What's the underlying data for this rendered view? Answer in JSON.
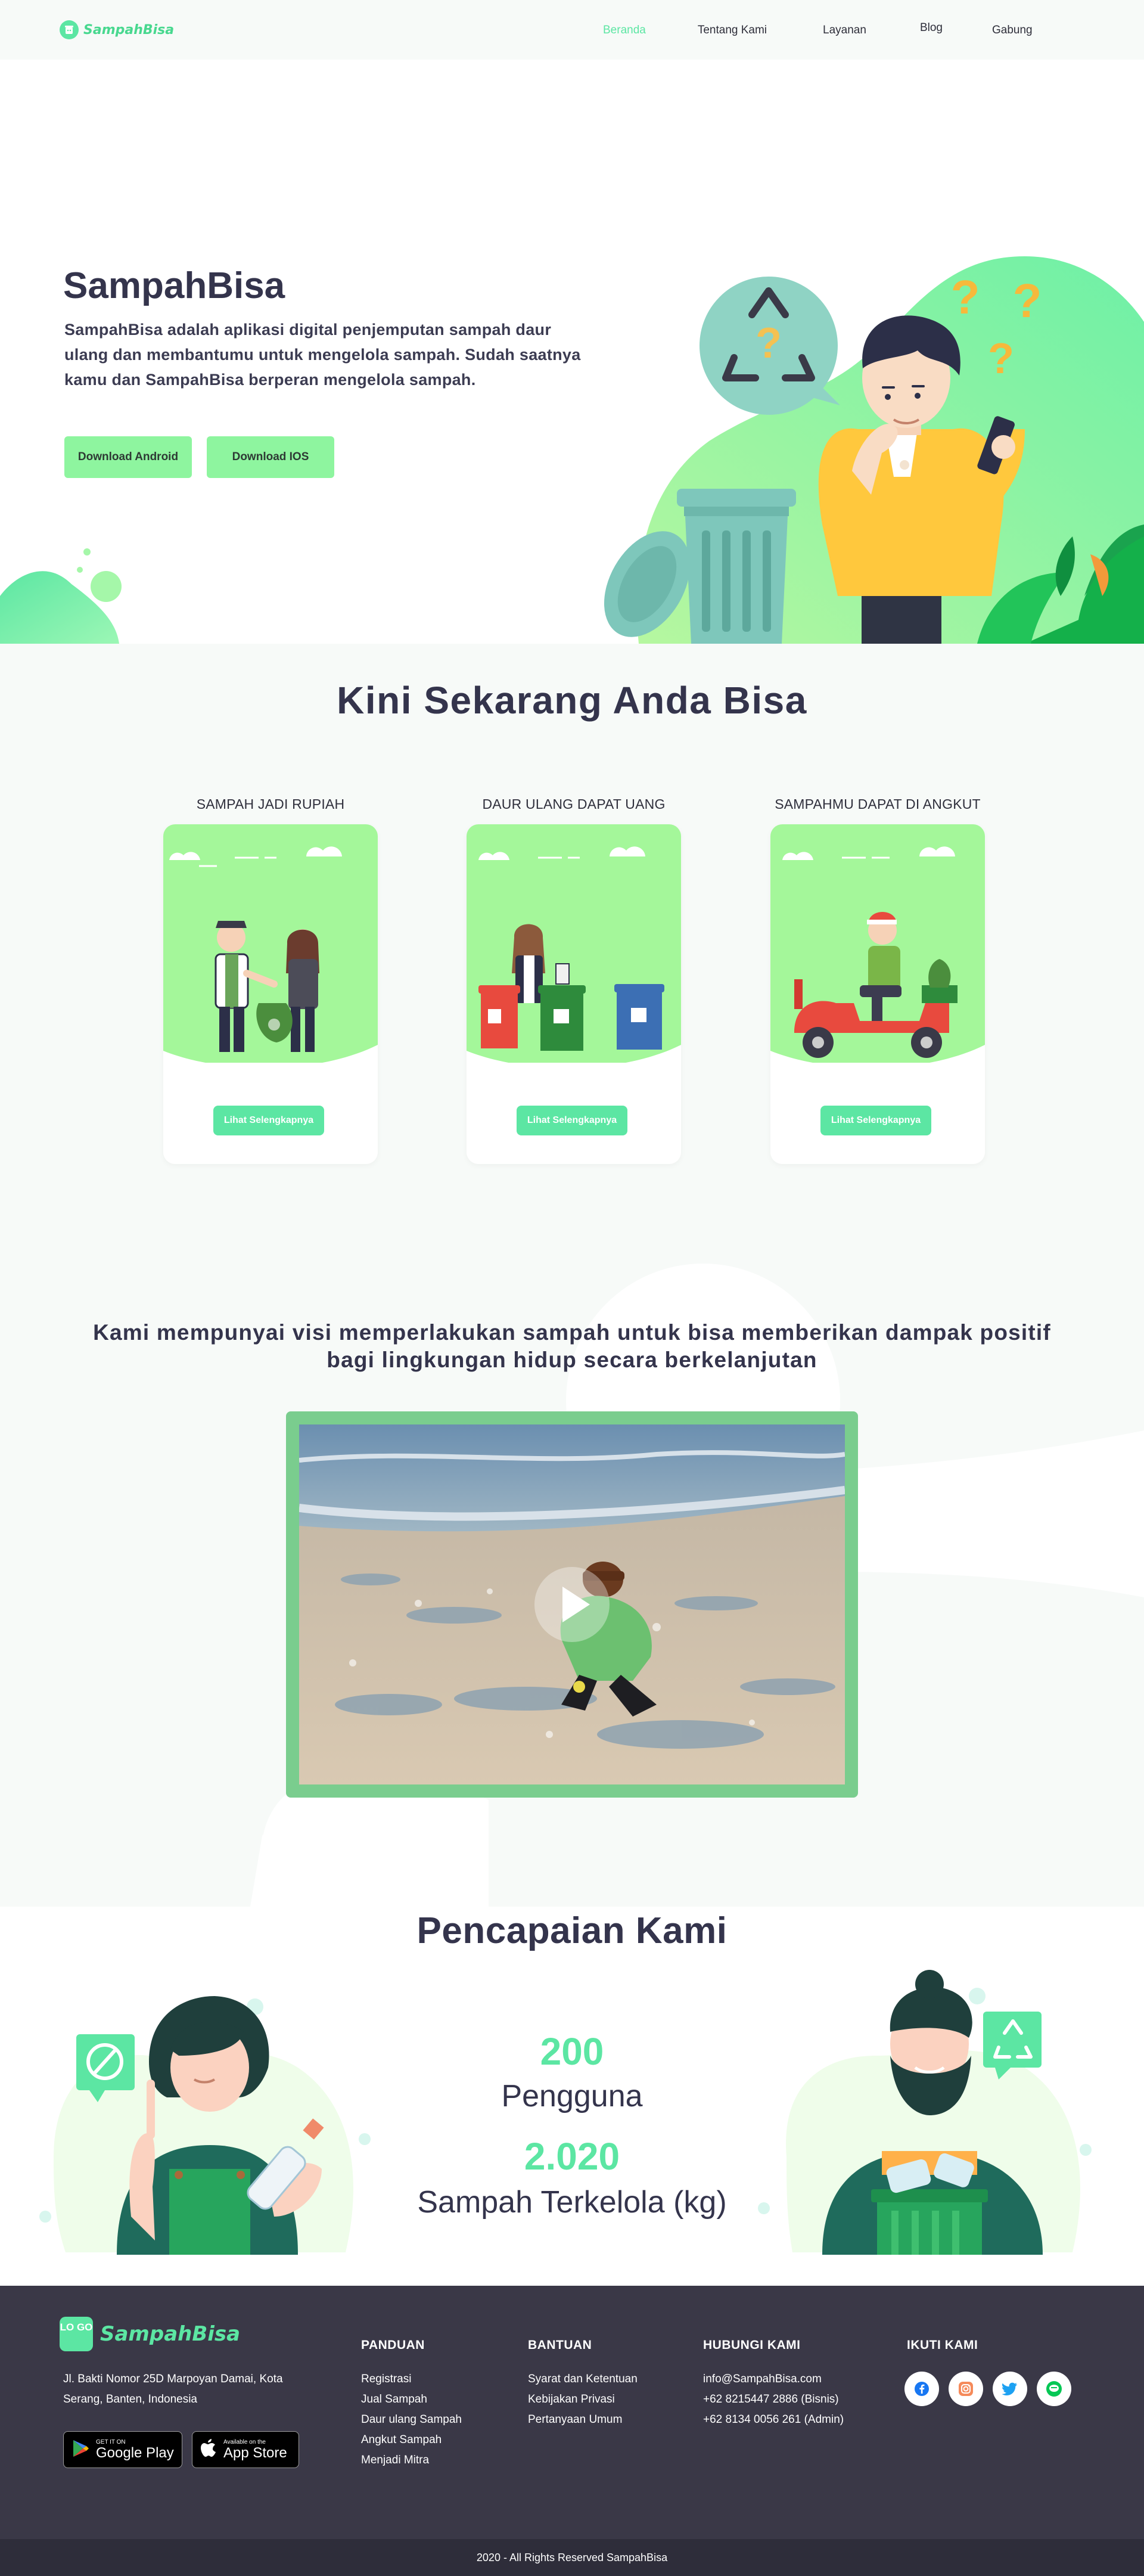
{
  "nav": {
    "brand": "SampahBisa",
    "links": [
      {
        "label": "Beranda",
        "active": true
      },
      {
        "label": "Tentang Kami",
        "active": false
      },
      {
        "label": "Layanan",
        "active": false
      },
      {
        "label": "Blog",
        "active": false
      },
      {
        "label": "Gabung",
        "active": false
      }
    ]
  },
  "hero": {
    "title": "SampahBisa",
    "description": "SampahBisa adalah aplikasi digital penjemputan sampah daur ulang dan membantumu untuk mengelola sampah. Sudah saatnya kamu dan SampahBisa berperan mengelola sampah.",
    "btn_android": "Download Android",
    "btn_ios": "Download IOS"
  },
  "kini": {
    "heading": "Kini Sekarang Anda Bisa",
    "cards": [
      {
        "title": "SAMPAH JADI RUPIAH",
        "button": "Lihat Selengkapnya"
      },
      {
        "title": "DAUR ULANG DAPAT UANG",
        "button": "Lihat Selengkapnya"
      },
      {
        "title": "SAMPAHMU DAPAT DI ANGKUT",
        "button": "Lihat Selengkapnya"
      }
    ]
  },
  "visi": {
    "text": "Kami mempunyai visi memperlakukan sampah untuk bisa memberikan dampak positif bagi lingkungan hidup secara berkelanjutan"
  },
  "pencapaian": {
    "heading": "Pencapaian Kami",
    "stats": [
      {
        "value": "200",
        "label": "Pengguna"
      },
      {
        "value": "2.020",
        "label": "Sampah Terkelola (kg)"
      }
    ]
  },
  "footer": {
    "logo_box": "LO GO",
    "brand": "SampahBisa",
    "address": "Jl. Bakti Nomor 25D Marpoyan Damai, Kota Serang, Banten, Indonesia",
    "google_play": {
      "small": "GET IT ON",
      "big": "Google Play"
    },
    "app_store": {
      "small": "Available on the",
      "big": "App Store"
    },
    "columns": [
      {
        "title": "PANDUAN",
        "items": [
          "Registrasi",
          "Jual Sampah",
          "Daur ulang Sampah",
          "Angkut Sampah",
          "Menjadi Mitra"
        ]
      },
      {
        "title": "BANTUAN",
        "items": [
          "Syarat dan Ketentuan",
          "Kebijakan Privasi",
          "Pertanyaan Umum"
        ]
      },
      {
        "title": "HUBUNGI KAMI",
        "items": [
          "info@SampahBisa.com",
          "+62 8215447 2886 (Bisnis)",
          "+62 8134 0056 261 (Admin)"
        ]
      },
      {
        "title": "IKUTI KAMI",
        "items": []
      }
    ],
    "socials": [
      "facebook-icon",
      "instagram-icon",
      "twitter-icon",
      "line-icon"
    ],
    "copyright": "2020 - All Rights Reserved SampahBisa"
  },
  "colors": {
    "accent": "#5ce6a3",
    "button_light": "#8ef59f",
    "dark": "#34344c",
    "footer": "#3a3847",
    "video_border": "#7acd8e"
  }
}
